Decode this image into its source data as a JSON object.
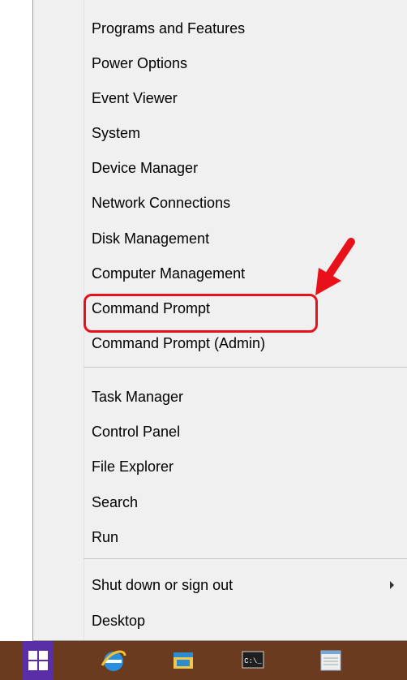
{
  "menu": {
    "items": [
      {
        "label": "Programs and Features"
      },
      {
        "label": "Power Options"
      },
      {
        "label": "Event Viewer"
      },
      {
        "label": "System"
      },
      {
        "label": "Device Manager"
      },
      {
        "label": "Network Connections"
      },
      {
        "label": "Disk Management"
      },
      {
        "label": "Computer Management"
      },
      {
        "label": "Command Prompt"
      },
      {
        "label": "Command Prompt (Admin)"
      },
      {
        "label": "Task Manager"
      },
      {
        "label": "Control Panel"
      },
      {
        "label": "File Explorer"
      },
      {
        "label": "Search"
      },
      {
        "label": "Run"
      },
      {
        "label": "Shut down or sign out"
      },
      {
        "label": "Desktop"
      }
    ]
  },
  "taskbar": {
    "cmd_label": "C:\\_"
  },
  "colors": {
    "highlight": "#e8111a",
    "taskbar": "#6b3b1f",
    "start_button": "#5a2ea6",
    "menu_background": "#f0f0f0"
  },
  "icons": [
    "start-icon",
    "internet-explorer-icon",
    "file-explorer-icon",
    "command-prompt-icon",
    "notepad-icon",
    "submenu-arrow-icon",
    "red-pointer-arrow-icon"
  ]
}
